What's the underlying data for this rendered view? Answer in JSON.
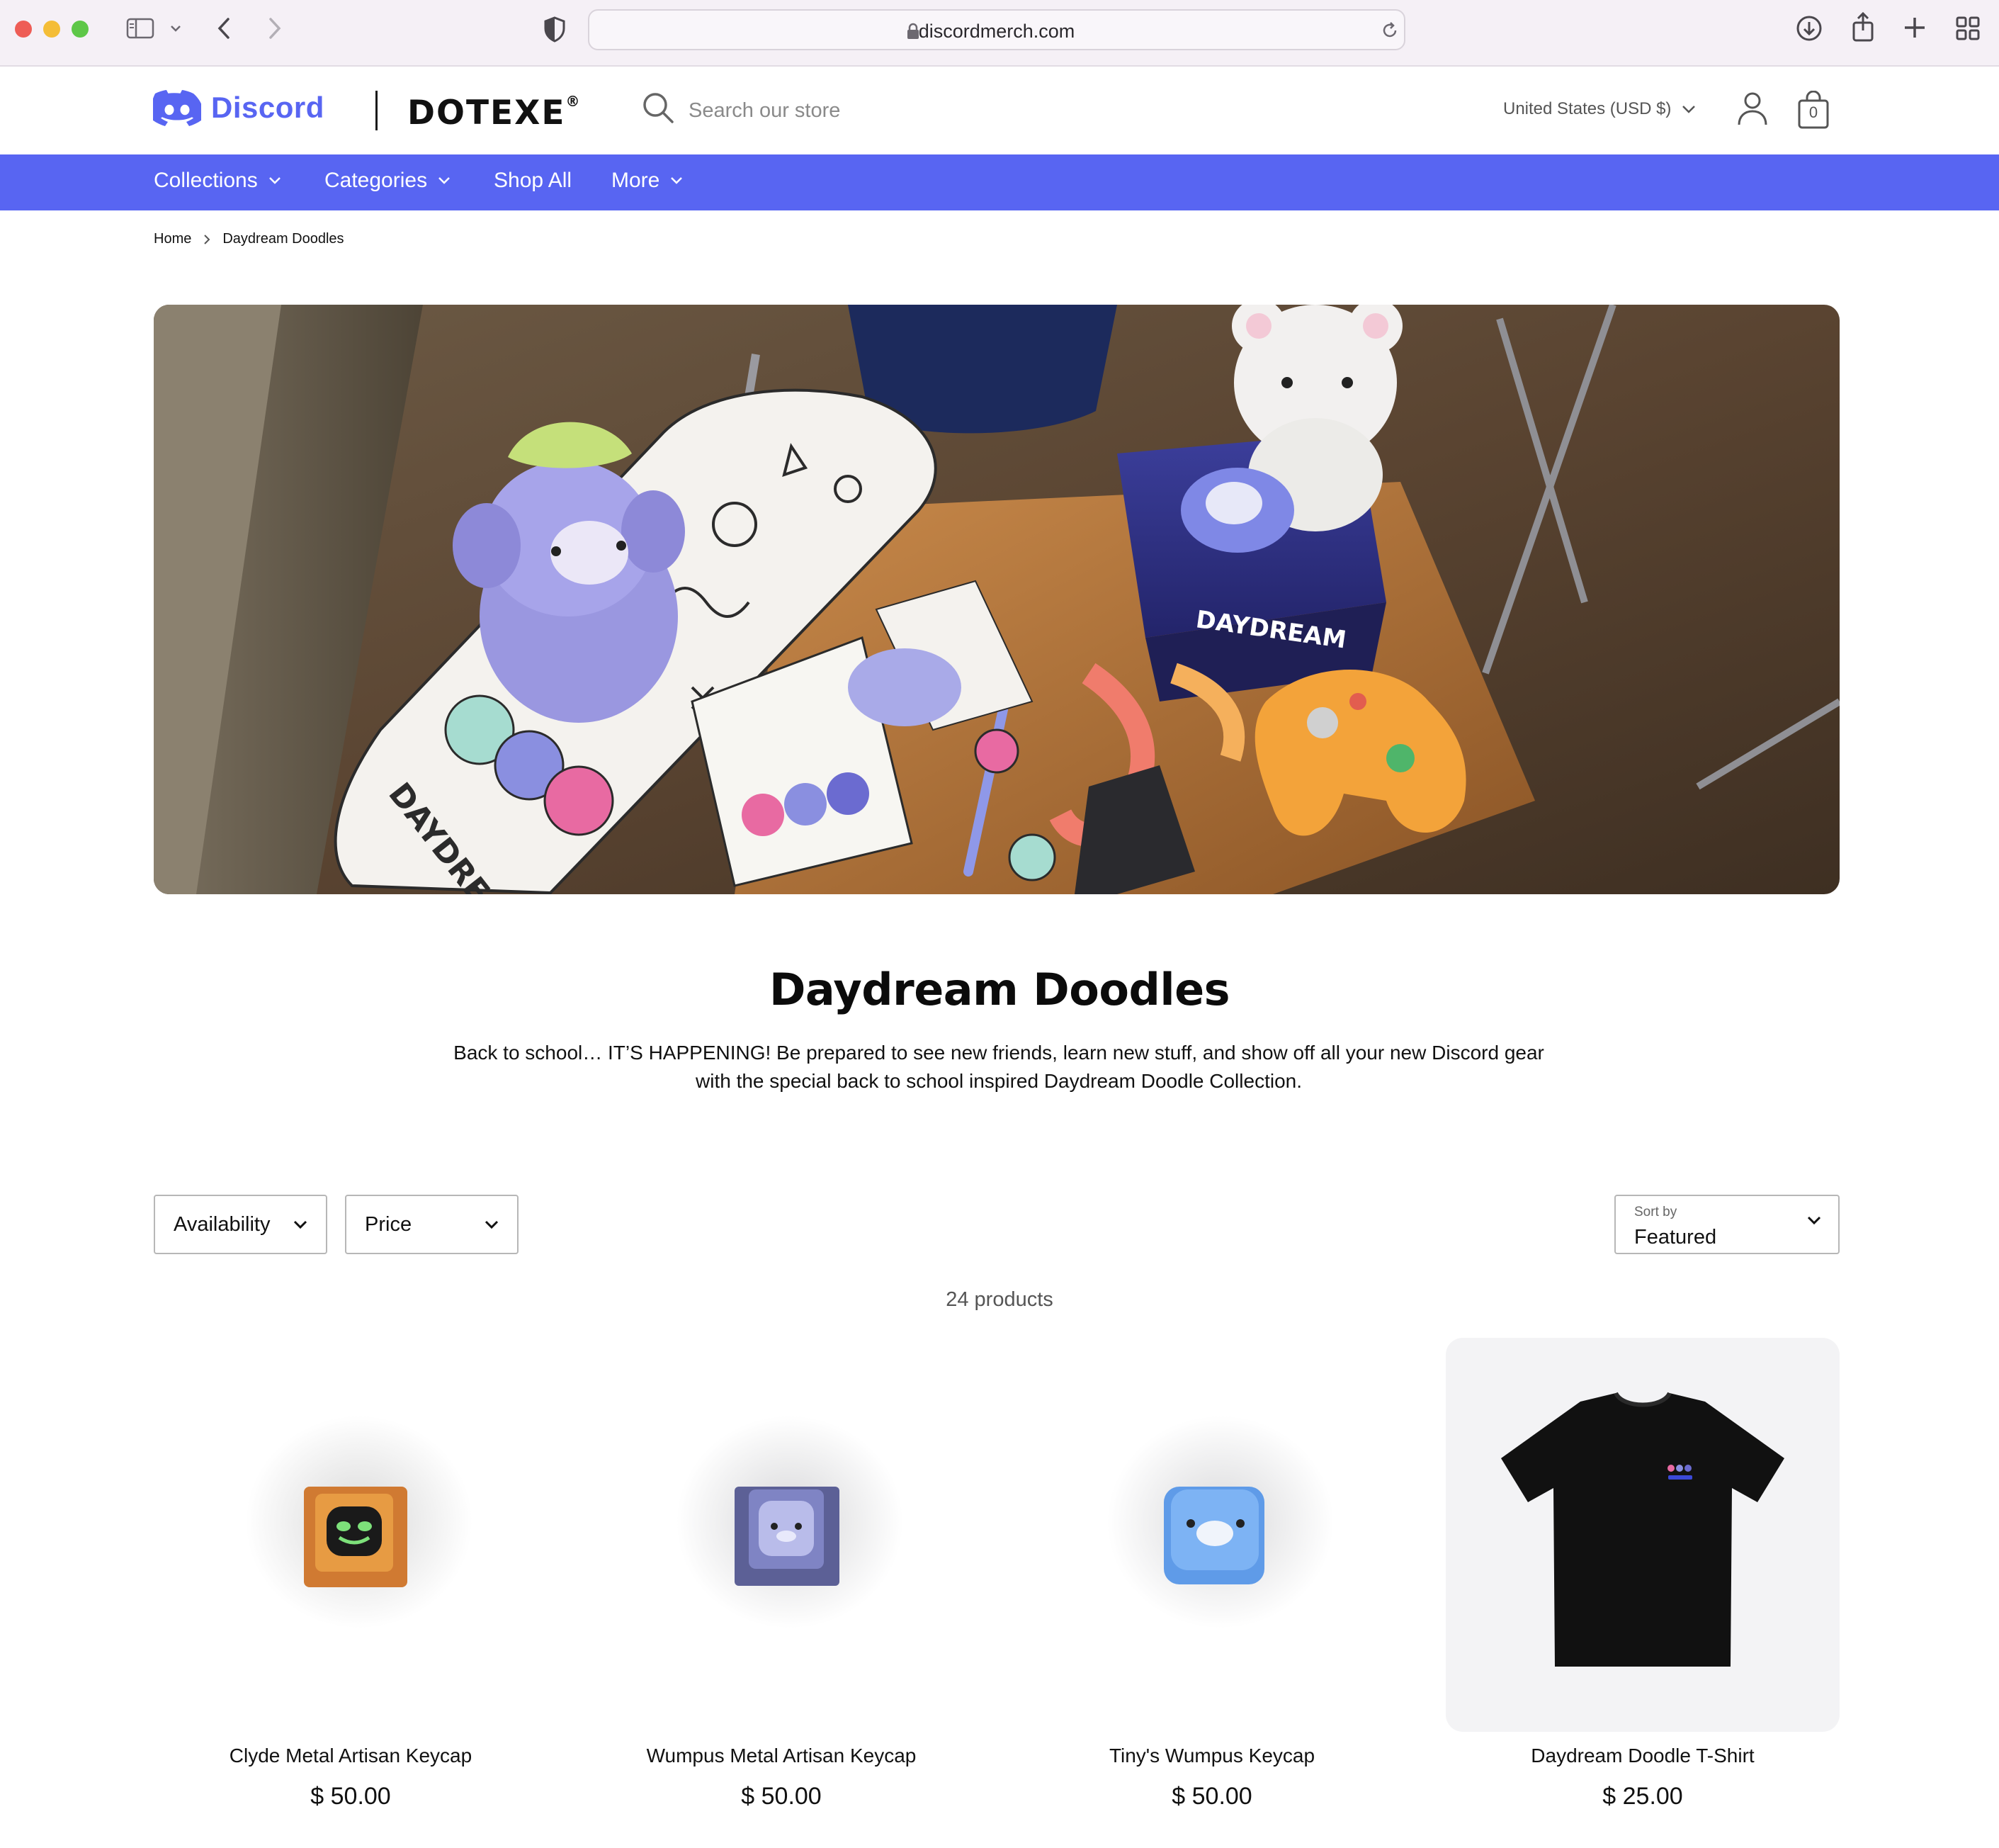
{
  "browser": {
    "url": "discordmerch.com"
  },
  "header": {
    "brand": "Discord",
    "partner": "DOTEXE",
    "partner_mark": "®",
    "search_placeholder": "Search our store",
    "currency": "United States (USD $)",
    "cart_count": "0"
  },
  "nav": {
    "items": [
      {
        "label": "Collections",
        "has_dropdown": true
      },
      {
        "label": "Categories",
        "has_dropdown": true
      },
      {
        "label": "Shop All",
        "has_dropdown": false
      },
      {
        "label": "More",
        "has_dropdown": true
      }
    ]
  },
  "breadcrumb": {
    "home": "Home",
    "current": "Daydream Doodles"
  },
  "collection": {
    "title": "Daydream Doodles",
    "description": "Back to school… IT’S HAPPENING! Be prepared to see new friends, learn new stuff, and show off all your new Discord gear with the special back to school inspired Daydream Doodle Collection."
  },
  "filters": {
    "availability": "Availability",
    "price": "Price",
    "sort_label": "Sort by",
    "sort_value": "Featured",
    "product_count": "24 products"
  },
  "products": [
    {
      "name": "Clyde Metal Artisan Keycap",
      "price": "$ 50.00",
      "icon": "clyde-keycap"
    },
    {
      "name": "Wumpus Metal Artisan Keycap",
      "price": "$ 50.00",
      "icon": "wumpus-metal-keycap"
    },
    {
      "name": "Tiny's Wumpus Keycap",
      "price": "$ 50.00",
      "icon": "tiny-wumpus-keycap"
    },
    {
      "name": "Daydream Doodle T-Shirt",
      "price": "$ 25.00",
      "icon": "black-tshirt"
    }
  ],
  "hero_labels": {
    "board": "DAYDREAM",
    "box": "DAYDREAM"
  },
  "colors": {
    "brand": "#5865f2",
    "nav_text": "#ffffff"
  }
}
